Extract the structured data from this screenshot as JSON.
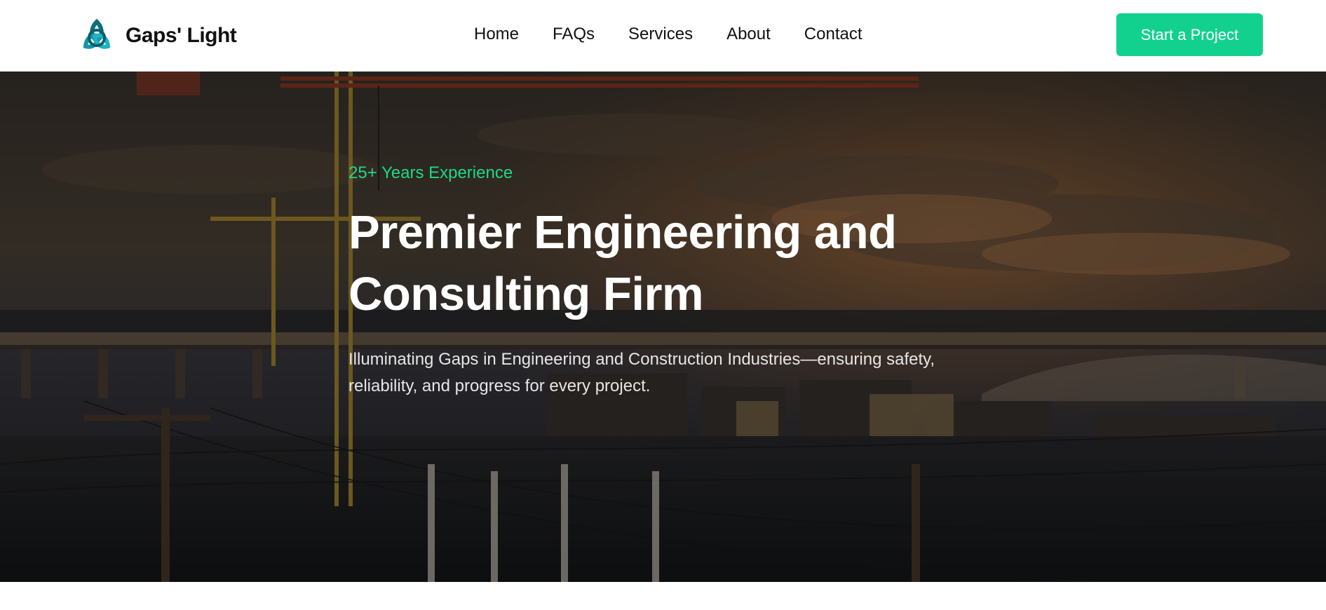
{
  "brand": {
    "name": "Gaps' Light",
    "logo_icon": "triquetra-knot-icon",
    "logo_color": "#1a9aa8"
  },
  "nav": {
    "items": [
      {
        "label": "Home"
      },
      {
        "label": "FAQs"
      },
      {
        "label": "Services"
      },
      {
        "label": "About"
      },
      {
        "label": "Contact"
      }
    ],
    "cta_label": "Start a Project"
  },
  "hero": {
    "background_image": "construction-cranes-city-sunset-photo",
    "eyebrow": "25+ Years Experience",
    "title": "Premier Engineering and Consulting Firm",
    "subtitle": "Illuminating Gaps in Engineering and Construction Industries—ensuring safety, reliability, and progress for every project."
  },
  "colors": {
    "accent": "#12d18e",
    "eyebrow": "#1fd886",
    "text_dark": "#111111",
    "hero_overlay": "#000000"
  }
}
